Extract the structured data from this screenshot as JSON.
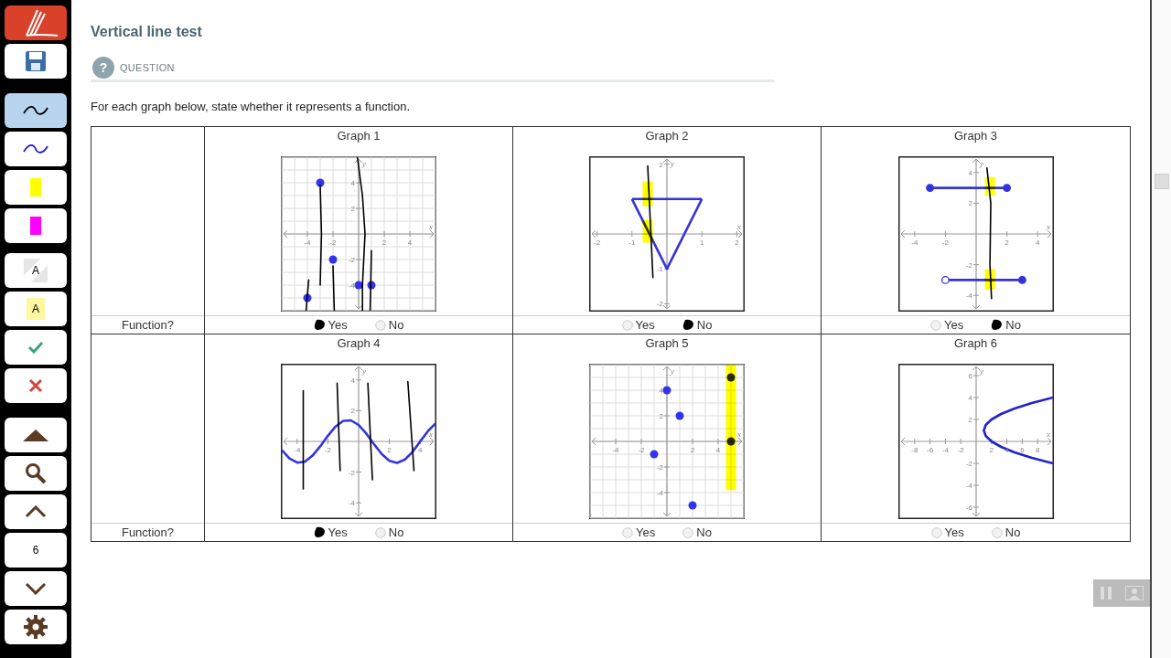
{
  "toolbar": {
    "items": [
      {
        "kind": "logo",
        "selected": false
      },
      {
        "kind": "save",
        "selected": false
      },
      {
        "kind": "pen",
        "color": "#000000",
        "selected": true
      },
      {
        "kind": "pen",
        "color": "#1a1ad0",
        "selected": false
      },
      {
        "kind": "highlighter",
        "color": "#ffff00",
        "selected": false
      },
      {
        "kind": "highlighter",
        "color": "#ff00ff",
        "selected": false
      },
      {
        "kind": "textbox",
        "text": "A",
        "selected": false
      },
      {
        "kind": "note",
        "text": "A",
        "selected": false
      },
      {
        "kind": "check",
        "selected": false
      },
      {
        "kind": "cross",
        "selected": false
      },
      {
        "kind": "top",
        "selected": false
      },
      {
        "kind": "search",
        "selected": false
      },
      {
        "kind": "prev",
        "selected": false
      },
      {
        "kind": "page",
        "text": "6",
        "selected": false
      },
      {
        "kind": "next",
        "selected": false
      },
      {
        "kind": "settings",
        "selected": false
      }
    ]
  },
  "title": "Vertical line test",
  "section": {
    "icon": "?",
    "label": "QUESTION"
  },
  "prompt": "For each graph below, state whether it represents a function.",
  "rows": [
    {
      "label": "Function?",
      "graphs": [
        {
          "title": "Graph 1",
          "chart_data": {
            "type": "scatter",
            "grid": true,
            "xlabel": "x",
            "ylabel": "y",
            "xlim": [
              -6,
              6
            ],
            "ylim": [
              -6,
              6
            ],
            "xticks": [
              -4,
              -2,
              2,
              4
            ],
            "yticks": [
              -4,
              -2,
              2,
              4
            ],
            "series": [
              {
                "color": "#3333ee",
                "x": [
                  -3,
                  -2,
                  0,
                  1,
                  -4
                ],
                "values": [
                  4,
                  -2,
                  -4,
                  -4,
                  -5
                ]
              }
            ]
          },
          "choices": [
            {
              "label": "Yes",
              "selected": true
            },
            {
              "label": "No",
              "selected": false
            }
          ]
        },
        {
          "title": "Graph 2",
          "chart_data": {
            "type": "line",
            "grid": false,
            "xlabel": "x",
            "ylabel": "y",
            "xlim": [
              -2.2,
              2.2
            ],
            "ylim": [
              -2.2,
              2.2
            ],
            "xticks": [
              -2,
              -1,
              1,
              2
            ],
            "yticks": [
              -2,
              -1,
              2
            ],
            "series": [
              {
                "color": "#3333dd",
                "x": [
                  -1,
                  1
                ],
                "values": [
                  1,
                  1
                ]
              },
              {
                "color": "#3333dd",
                "x": [
                  -1,
                  0,
                  1
                ],
                "values": [
                  1,
                  -1,
                  1
                ]
              }
            ]
          },
          "choices": [
            {
              "label": "Yes",
              "selected": false
            },
            {
              "label": "No",
              "selected": true
            }
          ]
        },
        {
          "title": "Graph 3",
          "chart_data": {
            "type": "line",
            "grid": false,
            "xlabel": "x",
            "ylabel": "y",
            "xlim": [
              -5,
              5
            ],
            "ylim": [
              -5,
              5
            ],
            "xticks": [
              -4,
              -2,
              2,
              4
            ],
            "yticks": [
              -4,
              -2,
              2,
              4
            ],
            "series": [
              {
                "color": "#3333dd",
                "x": [
                  -3,
                  2
                ],
                "values": [
                  3,
                  3
                ],
                "marker": "o"
              },
              {
                "color": "#3333dd",
                "x": [
                  -2,
                  3
                ],
                "values": [
                  -3,
                  -3
                ]
              },
              {
                "color": "#3333dd",
                "x": [
                  3
                ],
                "values": [
                  -3
                ],
                "marker": "o"
              },
              {
                "color": "#3333dd",
                "x": [
                  -2
                ],
                "values": [
                  -3
                ],
                "marker": "open circle"
              }
            ]
          },
          "choices": [
            {
              "label": "Yes",
              "selected": false
            },
            {
              "label": "No",
              "selected": true
            }
          ]
        }
      ]
    },
    {
      "label": "Function?",
      "graphs": [
        {
          "title": "Graph 4",
          "chart_data": {
            "type": "line",
            "grid": false,
            "xlabel": "x",
            "ylabel": "y",
            "xlim": [
              -5,
              5
            ],
            "ylim": [
              -5,
              5
            ],
            "xticks": [
              -4,
              -2,
              2,
              4
            ],
            "yticks": [
              -4,
              -2,
              2,
              4
            ],
            "series": [
              {
                "color": "#3333dd",
                "x": [
                  -5,
                  -4.5,
                  -4,
                  -3.5,
                  -3,
                  -2.5,
                  -2,
                  -1.5,
                  -1,
                  -0.5,
                  0,
                  0.5,
                  1,
                  1.5,
                  2,
                  2.5,
                  3,
                  3.5,
                  4,
                  4.5,
                  5
                ],
                "values": [
                  -0.56,
                  -1.11,
                  -1.38,
                  -1.32,
                  -0.93,
                  -0.32,
                  0.37,
                  0.97,
                  1.34,
                  1.37,
                  1.07,
                  0.51,
                  -0.18,
                  -0.82,
                  -1.26,
                  -1.4,
                  -1.19,
                  -0.69,
                  -0.02,
                  0.66,
                  1.17
                ]
              }
            ]
          },
          "choices": [
            {
              "label": "Yes",
              "selected": true
            },
            {
              "label": "No",
              "selected": false
            }
          ]
        },
        {
          "title": "Graph 5",
          "chart_data": {
            "type": "scatter",
            "grid": true,
            "xlabel": "x",
            "ylabel": "y",
            "xlim": [
              -6,
              6
            ],
            "ylim": [
              -6,
              6
            ],
            "xticks": [
              -4,
              -2,
              2,
              4
            ],
            "yticks": [
              -4,
              -2,
              2,
              4
            ],
            "series": [
              {
                "color": "#3333ee",
                "x": [
                  0,
                  1,
                  -1,
                  2
                ],
                "values": [
                  4,
                  2,
                  -1,
                  -5
                ]
              }
            ]
          },
          "choices": [
            {
              "label": "Yes",
              "selected": false
            },
            {
              "label": "No",
              "selected": false
            }
          ]
        },
        {
          "title": "Graph 6",
          "chart_data": {
            "type": "line",
            "grid": false,
            "xlabel": "x",
            "ylabel": "y",
            "xlim": [
              -10,
              10
            ],
            "ylim": [
              -7,
              7
            ],
            "xticks": [
              -8,
              -6,
              -4,
              -2,
              2,
              4,
              6,
              8
            ],
            "yticks": [
              -6,
              -4,
              -2,
              2,
              4,
              6
            ],
            "series": [
              {
                "color": "#2222cc",
                "x": [
                  10,
                  7.25,
                  5,
                  3.25,
                  2,
                  1.25,
                  1,
                  1.25,
                  2,
                  3.25,
                  5,
                  7.25,
                  10
                ],
                "values": [
                  -2,
                  -1.5,
                  -1,
                  -0.5,
                  0,
                  0.5,
                  1,
                  1.5,
                  2,
                  2.5,
                  3,
                  3.5,
                  4
                ]
              }
            ]
          },
          "choices": [
            {
              "label": "Yes",
              "selected": false
            },
            {
              "label": "No",
              "selected": false
            }
          ]
        }
      ]
    }
  ]
}
